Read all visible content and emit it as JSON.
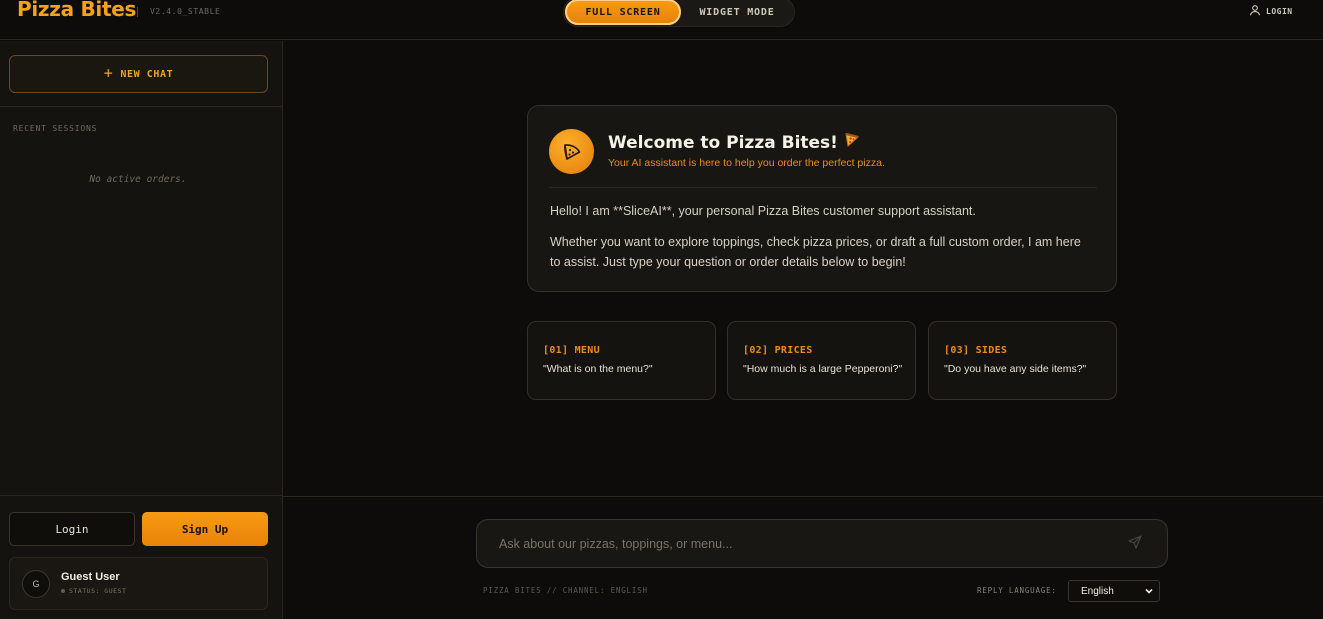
{
  "header": {
    "brand": "Pizza Bites",
    "version": "V2.4.0_STABLE",
    "modes": {
      "full_screen": "FULL SCREEN",
      "widget": "WIDGET MODE",
      "active": "full_screen"
    },
    "login": "LOGIN"
  },
  "sidebar": {
    "new_chat": "NEW CHAT",
    "recent_label": "RECENT SESSIONS",
    "empty_text": "No active orders.",
    "login_button": "Login",
    "signup_button": "Sign Up",
    "user": {
      "initial": "G",
      "name": "Guest User",
      "status": "STATUS: GUEST"
    }
  },
  "welcome": {
    "title": "Welcome to Pizza Bites!",
    "subtitle": "Your AI assistant is here to help you order the perfect pizza.",
    "body1": "Hello! I am **SliceAI**, your personal Pizza Bites customer support assistant.",
    "body2": "Whether you want to explore toppings, check pizza prices, or draft a full custom order, I am here to assist. Just type your question or order details below to begin!"
  },
  "suggestions": [
    {
      "tag": "[01] MENU",
      "question": "\"What is on the menu?\""
    },
    {
      "tag": "[02] PRICES",
      "question": "\"How much is a large Pepperoni?\""
    },
    {
      "tag": "[03] SIDES",
      "question": "\"Do you have any side items?\""
    }
  ],
  "input": {
    "placeholder": "Ask about our pizzas, toppings, or menu..."
  },
  "footer": {
    "channel": "PIZZA BITES // CHANNEL: ENGLISH",
    "reply_label": "REPLY LANGUAGE:",
    "language": "English"
  },
  "colors": {
    "accent": "#f5a214",
    "background": "#0d0c0a",
    "panel": "#15130f"
  }
}
